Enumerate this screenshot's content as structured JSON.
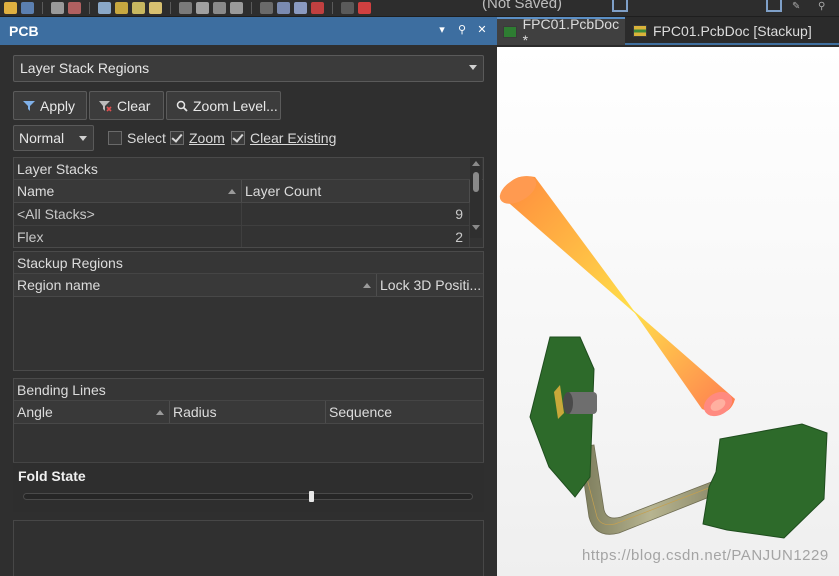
{
  "window": {
    "status_text": "(Not Saved)"
  },
  "panel": {
    "title": "PCB",
    "mode_dropdown": "Layer Stack Regions",
    "buttons": {
      "apply": "Apply",
      "clear": "Clear",
      "zoom_level": "Zoom Level..."
    },
    "filter_mode": "Normal",
    "checkboxes": {
      "select": "Select",
      "zoom": "Zoom",
      "clear_existing": "Clear Existing"
    },
    "layer_stacks": {
      "title": "Layer Stacks",
      "columns": [
        "Name",
        "Layer Count"
      ],
      "rows": [
        [
          "<All Stacks>",
          "9"
        ],
        [
          "Flex",
          "2"
        ]
      ]
    },
    "stackup_regions": {
      "title": "Stackup Regions",
      "columns": [
        "Region name",
        "Lock 3D Positi..."
      ]
    },
    "bending_lines": {
      "title": "Bending Lines",
      "columns": [
        "Angle",
        "Radius",
        "Sequence"
      ]
    },
    "fold_state": {
      "title": "Fold State",
      "value_fraction": 0.64
    }
  },
  "tabs": [
    {
      "label": "FPC01.PcbDoc *",
      "active": true
    },
    {
      "label": "FPC01.PcbDoc [Stackup]",
      "active": false
    }
  ],
  "viewport": {
    "watermark": "https://blog.csdn.net/PANJUN1229"
  },
  "colors": {
    "header_blue": "#3d6ea0",
    "board_green": "#2d6a2a",
    "cone_orange": "#ff8a3d",
    "cone_yellow": "#ffe14a"
  }
}
